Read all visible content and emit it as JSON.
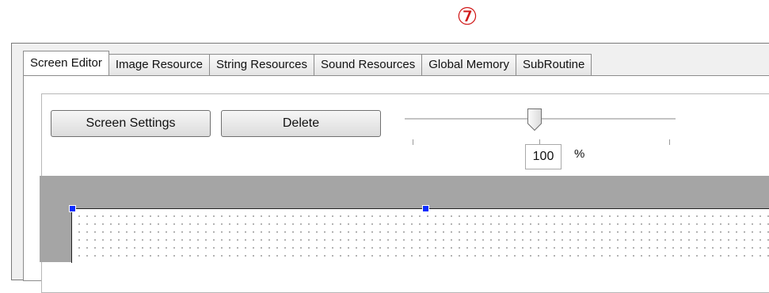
{
  "callout": {
    "marker": "⑦"
  },
  "tabs": [
    {
      "label": "Screen Editor",
      "active": true
    },
    {
      "label": "Image Resource"
    },
    {
      "label": "String Resources"
    },
    {
      "label": "Sound Resources"
    },
    {
      "label": "Global Memory"
    },
    {
      "label": "SubRoutine"
    }
  ],
  "toolbar": {
    "screen_settings_label": "Screen Settings",
    "delete_label": "Delete"
  },
  "zoom": {
    "value": "100",
    "unit": "%",
    "slider_fraction": 0.48
  },
  "colors": {
    "callout": "#d01818",
    "selection_handle": "#0a2cff",
    "canvas_background": "#a5a5a5"
  }
}
